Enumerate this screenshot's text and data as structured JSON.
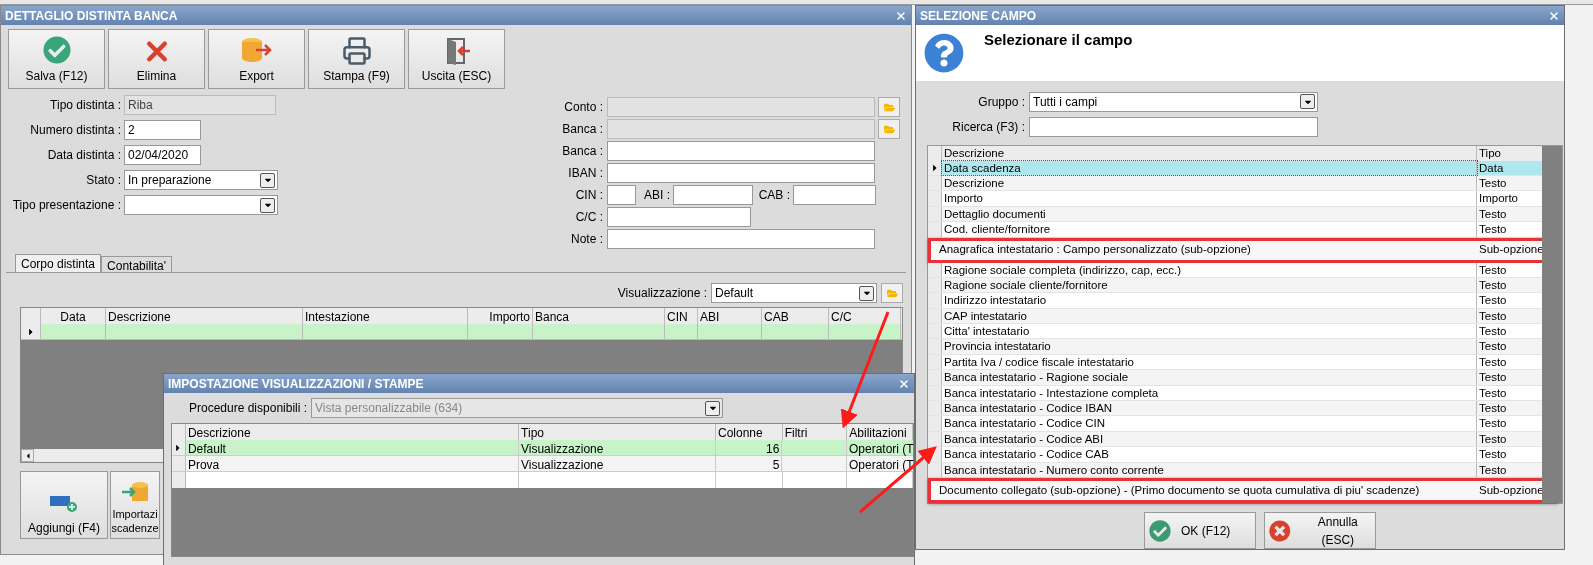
{
  "detail_window": {
    "title": "DETTAGLIO DISTINTA BANCA",
    "toolbar": [
      {
        "label": "Salva (F12)"
      },
      {
        "label": "Elimina"
      },
      {
        "label": "Export"
      },
      {
        "label": "Stampa (F9)"
      },
      {
        "label": "Uscita (ESC)"
      }
    ],
    "fields_left": [
      {
        "kind": "text",
        "label": "Tipo distinta :",
        "value": "Riba",
        "disabled": true
      },
      {
        "kind": "text",
        "label": "Numero distinta :",
        "value": "2",
        "disabled": false
      },
      {
        "kind": "text",
        "label": "Data distinta :",
        "value": "02/04/2020",
        "disabled": false
      },
      {
        "kind": "dropdown",
        "label": "Stato :",
        "value": "In preparazione",
        "disabled": false
      },
      {
        "kind": "dropdown",
        "label": "Tipo presentazione :",
        "disabled": false
      }
    ],
    "fields_right": [
      {
        "kind": "lookup",
        "label": "Conto :",
        "disabled": true
      },
      {
        "kind": "lookup",
        "label": "Banca :",
        "disabled": true
      },
      {
        "kind": "text",
        "label": "Banca :",
        "disabled": false
      },
      {
        "kind": "text",
        "label": "IBAN :",
        "disabled": false
      },
      {
        "kind": "codes",
        "label": "CIN :",
        "disabled": false,
        "parts": [
          {
            "label": "ABI :"
          },
          {
            "label": "CAB :"
          }
        ]
      },
      {
        "kind": "short",
        "label": "C/C :",
        "disabled": false
      },
      {
        "kind": "text",
        "label": "Note :",
        "disabled": false
      }
    ],
    "tabs": [
      {
        "label": "Corpo distinta",
        "selected": true
      },
      {
        "label": "Contabilita'",
        "selected": false
      }
    ],
    "view": {
      "label": "Visualizzazione :",
      "value": "Default"
    },
    "grid": {
      "columns": [
        "Data",
        "Descrizione",
        "Intestazione",
        "Importo",
        "Banca",
        "CIN",
        "ABI",
        "CAB",
        "C/C"
      ],
      "rows": [
        {
          "selected": true
        }
      ]
    },
    "bottom_buttons": [
      {
        "lines": [
          "Aggiungi (F4)"
        ]
      },
      {
        "lines": [
          "Importazi",
          "scadenze"
        ]
      }
    ]
  },
  "views_window": {
    "title": "IMPOSTAZIONE VISUALIZZAZIONI / STAMPE",
    "procedure": {
      "label": "Procedure disponibili :",
      "value": "Vista personalizzabile (634)",
      "disabled": true
    },
    "columns": [
      "Descrizione",
      "Tipo",
      "Colonne",
      "Filtri",
      "Abilitazioni"
    ],
    "rows": [
      {
        "descrizione": "Default",
        "tipo": "Visualizzazione",
        "colonne": "16",
        "abilitazioni": "Operatori (T",
        "selected": true
      },
      {
        "descrizione": "Prova",
        "tipo": "Visualizzazione",
        "colonne": "5",
        "abilitazioni": "Operatori (T",
        "selected": false
      }
    ]
  },
  "field_window": {
    "title": "SELEZIONE CAMPO",
    "heading": "Selezionare il campo",
    "gruppo": {
      "label": "Gruppo :",
      "value": "Tutti i campi"
    },
    "search": {
      "label": "Ricerca (F3) :"
    },
    "columns": [
      "Descrizione",
      "Tipo"
    ],
    "rows": [
      {
        "kind": "row",
        "descrizione": "Data scadenza",
        "tipo": "Data",
        "selected": true
      },
      {
        "kind": "row",
        "descrizione": "Descrizione",
        "tipo": "Testo",
        "selected": false
      },
      {
        "kind": "row",
        "descrizione": "Importo",
        "tipo": "Importo",
        "selected": false
      },
      {
        "kind": "row",
        "descrizione": "Dettaglio documenti",
        "tipo": "Testo",
        "selected": false
      },
      {
        "kind": "row",
        "descrizione": "Cod. cliente/fornitore",
        "tipo": "Testo",
        "selected": false
      },
      {
        "kind": "highlight",
        "descrizione": "Anagrafica intestatario : Campo personalizzato (sub-opzione)",
        "tipo": "Sub-opzione",
        "selected": false
      },
      {
        "kind": "row",
        "descrizione": "Ragione sociale completa (indirizzo, cap, ecc.)",
        "tipo": "Testo",
        "selected": false
      },
      {
        "kind": "row",
        "descrizione": "Ragione sociale cliente/fornitore",
        "tipo": "Testo",
        "selected": false
      },
      {
        "kind": "row",
        "descrizione": "Indirizzo intestatario",
        "tipo": "Testo",
        "selected": false
      },
      {
        "kind": "row",
        "descrizione": "CAP intestatario",
        "tipo": "Testo",
        "selected": false
      },
      {
        "kind": "row",
        "descrizione": "Citta' intestatario",
        "tipo": "Testo",
        "selected": false
      },
      {
        "kind": "row",
        "descrizione": "Provincia intestatario",
        "tipo": "Testo",
        "selected": false
      },
      {
        "kind": "row",
        "descrizione": "Partita Iva / codice fiscale intestatario",
        "tipo": "Testo",
        "selected": false
      },
      {
        "kind": "row",
        "descrizione": "Banca intestatario - Ragione sociale",
        "tipo": "Testo",
        "selected": false
      },
      {
        "kind": "row",
        "descrizione": "Banca intestatario - Intestazione completa",
        "tipo": "Testo",
        "selected": false
      },
      {
        "kind": "row",
        "descrizione": "Banca intestatario - Codice IBAN",
        "tipo": "Testo",
        "selected": false
      },
      {
        "kind": "row",
        "descrizione": "Banca intestatario - Codice CIN",
        "tipo": "Testo",
        "selected": false
      },
      {
        "kind": "row",
        "descrizione": "Banca intestatario - Codice ABI",
        "tipo": "Testo",
        "selected": false
      },
      {
        "kind": "row",
        "descrizione": "Banca intestatario - Codice CAB",
        "tipo": "Testo",
        "selected": false
      },
      {
        "kind": "row",
        "descrizione": "Banca intestatario - Numero conto corrente",
        "tipo": "Testo",
        "selected": false
      },
      {
        "kind": "highlight",
        "descrizione": "Documento collegato (sub-opzione) - (Primo documento se quota cumulativa di piu' scadenze)",
        "tipo": "Sub-opzione",
        "selected": false
      }
    ],
    "buttons": [
      {
        "label": "OK (F12)"
      },
      {
        "label": "Annulla (ESC)"
      }
    ]
  }
}
